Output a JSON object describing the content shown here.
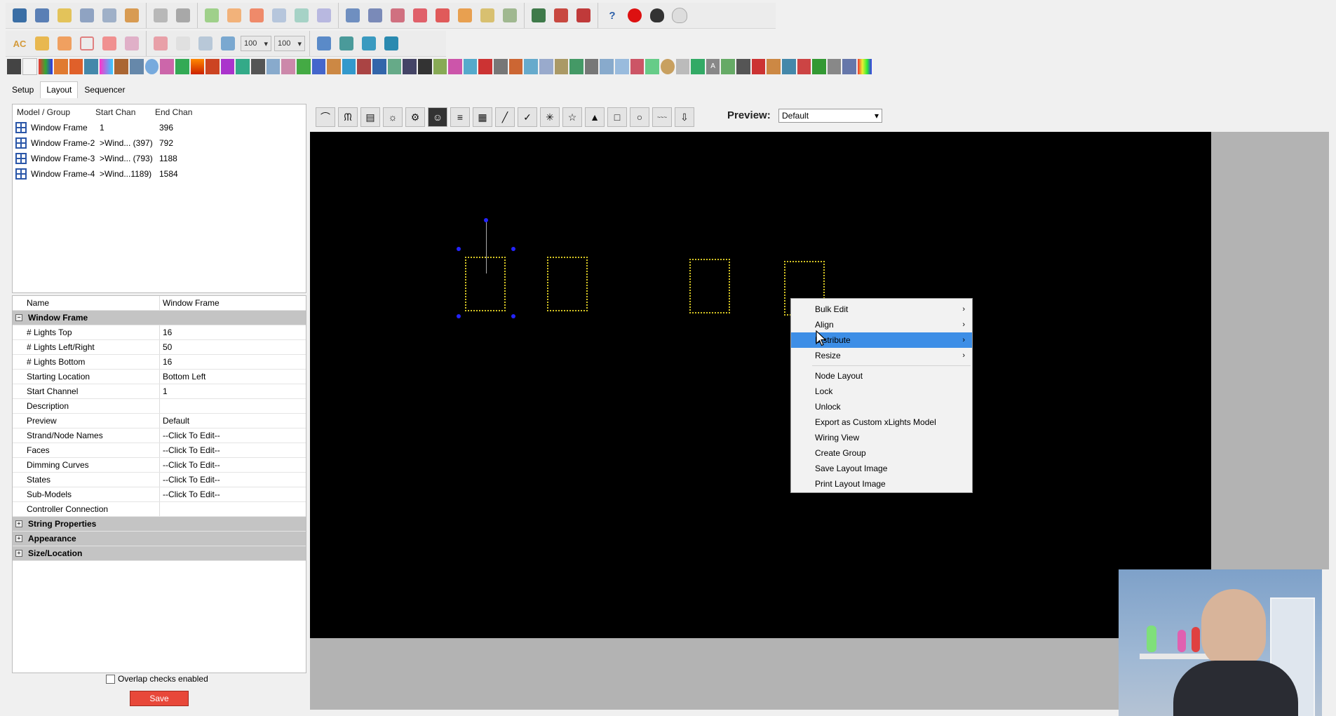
{
  "toolbar": {
    "zoom1": "100",
    "zoom2": "100"
  },
  "tabs": [
    "Setup",
    "Layout",
    "Sequencer"
  ],
  "model_list": {
    "headers": [
      "Model / Group",
      "Start Chan",
      "End Chan"
    ],
    "rows": [
      {
        "name": "Window Frame",
        "start": "1",
        "end": "396"
      },
      {
        "name": "Window Frame-2",
        "start": ">Wind... (397)",
        "end": "792"
      },
      {
        "name": "Window Frame-3",
        "start": ">Wind... (793)",
        "end": "1188"
      },
      {
        "name": "Window Frame-4",
        "start": ">Wind...1189)",
        "end": "1584"
      }
    ]
  },
  "properties": {
    "header_name": "Name",
    "header_value": "Window Frame",
    "section_title": "Window Frame",
    "rows": [
      {
        "name": "# Lights Top",
        "value": "16"
      },
      {
        "name": "# Lights Left/Right",
        "value": "50"
      },
      {
        "name": "# Lights Bottom",
        "value": "16"
      },
      {
        "name": "Starting Location",
        "value": "Bottom Left"
      },
      {
        "name": "Start Channel",
        "value": "1"
      },
      {
        "name": "Description",
        "value": ""
      },
      {
        "name": "Preview",
        "value": "Default"
      },
      {
        "name": "Strand/Node Names",
        "value": "--Click To Edit--"
      },
      {
        "name": "Faces",
        "value": "--Click To Edit--"
      },
      {
        "name": "Dimming Curves",
        "value": "--Click To Edit--"
      },
      {
        "name": "States",
        "value": "--Click To Edit--"
      },
      {
        "name": "Sub-Models",
        "value": "--Click To Edit--"
      },
      {
        "name": "Controller Connection",
        "value": ""
      }
    ],
    "collapsed_sections": [
      "String Properties",
      "Appearance",
      "Size/Location"
    ]
  },
  "overlap_label": "Overlap checks enabled",
  "save_label": "Save",
  "preview": {
    "label": "Preview:",
    "selected": "Default"
  },
  "context_menu": {
    "items": [
      {
        "label": "Bulk Edit",
        "submenu": true
      },
      {
        "label": "Align",
        "submenu": true
      },
      {
        "label": "Distribute",
        "submenu": true,
        "highlighted": true
      },
      {
        "label": "Resize",
        "submenu": true
      },
      {
        "label": "Node Layout",
        "submenu": false
      },
      {
        "label": "Lock",
        "submenu": false
      },
      {
        "label": "Unlock",
        "submenu": false
      },
      {
        "label": "Export as Custom xLights Model",
        "submenu": false
      },
      {
        "label": "Wiring View",
        "submenu": false
      },
      {
        "label": "Create Group",
        "submenu": false
      },
      {
        "label": "Save Layout Image",
        "submenu": false
      },
      {
        "label": "Print Layout Image",
        "submenu": false
      }
    ]
  },
  "colors": {
    "highlight": "#3d8ee6",
    "frame": "#d6c624",
    "handle": "#2424ff",
    "save_button": "#e8483a"
  }
}
